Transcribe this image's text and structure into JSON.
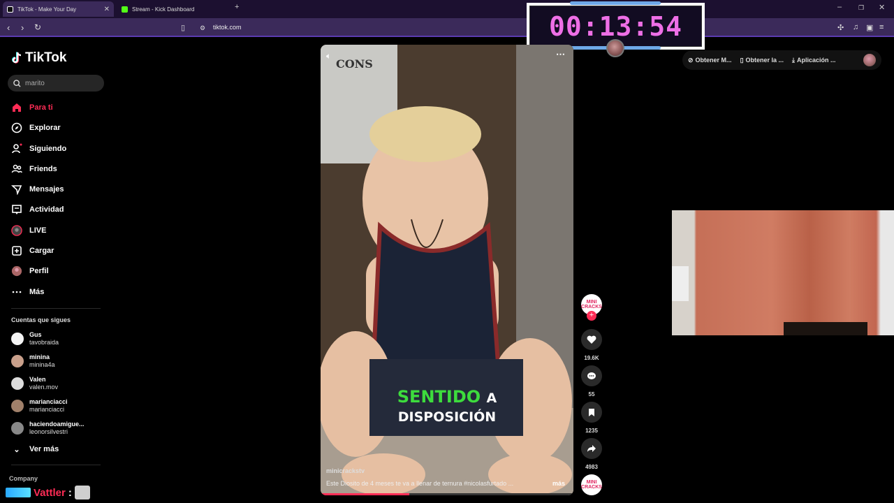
{
  "browser": {
    "tabs": [
      {
        "title": "TikTok - Make Your Day",
        "active": true
      },
      {
        "title": "Stream - Kick Dashboard",
        "active": false
      }
    ],
    "url": "tiktok.com"
  },
  "timer": {
    "value": "00:13:54",
    "color": "#ee6fe6"
  },
  "sidebar": {
    "logo": "TikTok",
    "search_value": "marito",
    "nav": [
      {
        "label": "Para ti",
        "icon": "home-icon",
        "active": true
      },
      {
        "label": "Explorar",
        "icon": "compass-icon"
      },
      {
        "label": "Siguiendo",
        "icon": "following-icon"
      },
      {
        "label": "Friends",
        "icon": "friends-icon"
      },
      {
        "label": "Mensajes",
        "icon": "messages-icon"
      },
      {
        "label": "Actividad",
        "icon": "activity-icon"
      },
      {
        "label": "LIVE",
        "icon": "live-icon"
      },
      {
        "label": "Cargar",
        "icon": "upload-icon"
      },
      {
        "label": "Perfil",
        "icon": "profile-avatar-icon"
      },
      {
        "label": "Más",
        "icon": "more-icon"
      }
    ],
    "following_title": "Cuentas que sigues",
    "accounts": [
      {
        "name": "Gus",
        "handle": "tavobraida"
      },
      {
        "name": "minina",
        "handle": "minina4a"
      },
      {
        "name": "Valen",
        "handle": "valen.mov"
      },
      {
        "name": "marianciacci",
        "handle": "marianciacci"
      },
      {
        "name": "haciendoamigue...",
        "handle": "leonorsilvestri"
      }
    ],
    "see_more": "Ver más",
    "company": "Company",
    "chat_user": "Vattler",
    "chat_sep": ":"
  },
  "video": {
    "caption_highlight": "SENTIDO",
    "caption_rest": "A",
    "caption_line2": "DISPOSICIÓN",
    "author": "minicrackstv",
    "description": "Este Diosito de 4 meses te va a llenar de ternura #nicolasfurtado ...",
    "more": "más",
    "progress": 0.35,
    "top_text": "CONS"
  },
  "actions": {
    "creator_badge": "MINI CRACKS",
    "likes": "19.6K",
    "comments": "55",
    "saves": "1235",
    "shares": "4983"
  },
  "header": {
    "coins": "Obtener M...",
    "app": "Obtener la ...",
    "download": "Aplicación ..."
  },
  "colors": {
    "accent": "#fe2c55",
    "browser": "#3b2a5a",
    "caption_green": "#3ddc3d"
  }
}
